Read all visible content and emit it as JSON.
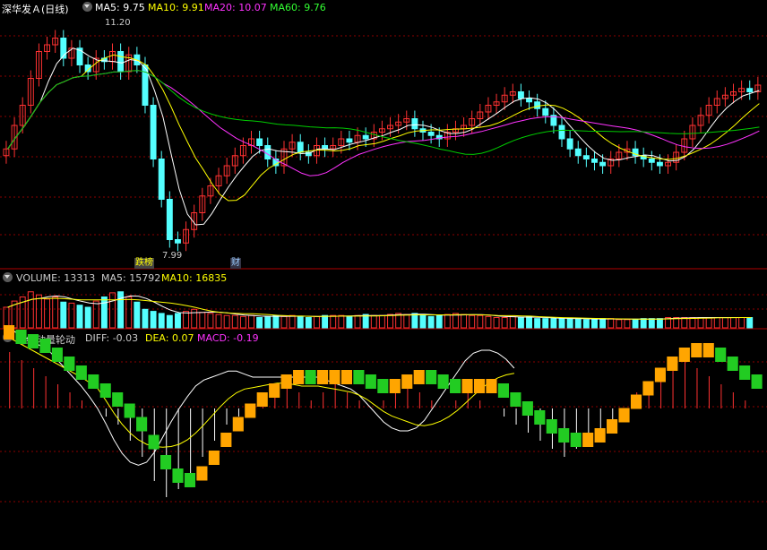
{
  "colors": {
    "up": "#ff3232",
    "down": "#54ffff",
    "ma5": "#ffffff",
    "ma10": "#ffff00",
    "ma20": "#ff33ff",
    "ma60": "#00cc00",
    "grid": "#8b0000",
    "orange": "#ffa500",
    "green": "#22cc22"
  },
  "price_panel": {
    "title": "深华发Ａ(日线)",
    "ma5_text": "MA5: 9.75",
    "ma10_text": "MA10: 9.91",
    "ma20_text": "MA20: 10.07",
    "ma60_text": "MA60: 9.76",
    "high_label": "11.20",
    "low_label": "7.99",
    "event_tag_1": "跌榜",
    "event_tag_2": "财"
  },
  "volume_panel": {
    "volume_text": "VOLUME: 13313",
    "ma5_text": "MA5: 15792",
    "ma10_text": "MA10: 16835"
  },
  "indicator_panel": {
    "title": "均线动量轮动",
    "diff_text": "DIFF: -0.03",
    "dea_text": "DEA: 0.07",
    "macd_text": "MACD: -0.19"
  },
  "chart_data": {
    "type": "candlestick",
    "low_marker": 7.99,
    "high_marker": 11.2,
    "closes": [
      9.45,
      9.8,
      10.1,
      10.5,
      10.9,
      11.0,
      11.1,
      10.8,
      10.95,
      10.7,
      10.6,
      10.8,
      10.75,
      10.9,
      10.6,
      10.85,
      10.7,
      10.1,
      9.3,
      8.7,
      8.1,
      8.05,
      8.25,
      8.5,
      8.75,
      8.9,
      9.05,
      9.2,
      9.35,
      9.5,
      9.6,
      9.5,
      9.3,
      9.2,
      9.45,
      9.55,
      9.4,
      9.35,
      9.5,
      9.45,
      9.5,
      9.6,
      9.55,
      9.65,
      9.6,
      9.7,
      9.75,
      9.8,
      9.85,
      9.9,
      9.75,
      9.7,
      9.65,
      9.6,
      9.7,
      9.75,
      9.8,
      9.9,
      10.0,
      10.1,
      10.15,
      10.25,
      10.3,
      10.2,
      10.15,
      10.05,
      9.95,
      9.8,
      9.6,
      9.45,
      9.35,
      9.3,
      9.25,
      9.2,
      9.3,
      9.4,
      9.45,
      9.35,
      9.3,
      9.25,
      9.2,
      9.25,
      9.4,
      9.6,
      9.8,
      9.95,
      10.1,
      10.2,
      10.25,
      10.3,
      10.35,
      10.3,
      10.4
    ],
    "volumes": [
      20,
      26,
      30,
      35,
      32,
      28,
      30,
      25,
      24,
      22,
      20,
      26,
      30,
      34,
      35,
      30,
      25,
      18,
      16,
      14,
      12,
      14,
      16,
      18,
      15,
      14,
      13,
      12,
      12,
      11,
      12,
      10,
      11,
      12,
      11,
      12,
      11,
      10,
      11,
      12,
      12,
      12,
      11,
      12,
      13,
      12,
      12,
      13,
      14,
      13,
      14,
      12,
      11,
      12,
      13,
      14,
      13,
      12,
      12,
      11,
      10,
      10,
      11,
      10,
      11,
      9,
      9,
      9,
      9,
      9,
      9,
      8,
      8,
      9,
      9,
      8,
      8,
      8,
      9,
      9,
      9,
      10,
      10,
      10,
      10,
      10,
      10,
      10,
      10,
      10,
      10,
      10
    ],
    "macd": [
      0.35,
      0.3,
      0.25,
      0.2,
      0.15,
      0.1,
      0.05,
      0.0,
      -0.05,
      -0.1,
      -0.2,
      -0.3,
      -0.45,
      -0.55,
      -0.5,
      -0.4,
      -0.3,
      -0.2,
      -0.1,
      -0.05,
      0.0,
      0.05,
      0.1,
      0.15,
      0.1,
      0.05,
      0.1,
      0.15,
      0.1,
      0.05,
      0.0,
      0.05,
      0.1,
      0.15,
      0.1,
      0.05,
      0.0,
      0.05,
      0.1,
      0.05,
      0.0,
      -0.05,
      -0.1,
      -0.15,
      -0.2,
      -0.25,
      -0.3,
      -0.25,
      -0.2,
      -0.15,
      -0.1,
      0.0,
      0.1,
      0.15,
      0.2,
      0.25,
      0.3,
      0.25,
      0.2,
      0.15,
      0.1,
      0.05,
      0.0
    ]
  }
}
